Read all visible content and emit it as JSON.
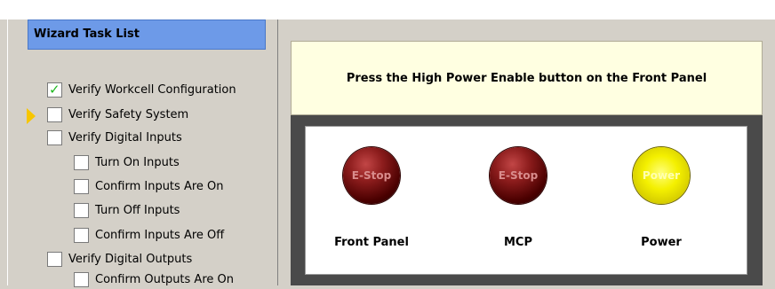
{
  "wizard": {
    "header": "Wizard Task List",
    "tasks": [
      {
        "label": "Verify Workcell Configuration",
        "checked": true
      },
      {
        "label": "Verify Safety System",
        "checked": false,
        "current": true
      },
      {
        "label": "Verify Digital Inputs",
        "checked": false
      },
      {
        "label": "Turn On Inputs",
        "checked": false
      },
      {
        "label": "Confirm Inputs Are On",
        "checked": false
      },
      {
        "label": "Turn Off Inputs",
        "checked": false
      },
      {
        "label": "Confirm Inputs Are Off",
        "checked": false
      },
      {
        "label": "Verify Digital Outputs",
        "checked": false
      },
      {
        "label": "Confirm Outputs Are On",
        "checked": false
      }
    ]
  },
  "instruction": "Press the High Power Enable button on the Front Panel",
  "indicators": [
    {
      "text": "E-Stop",
      "label": "Front Panel",
      "color": "#8d1d1d"
    },
    {
      "text": "E-Stop",
      "label": "MCP",
      "color": "#8d1d1d"
    },
    {
      "text": "Power",
      "label": "Power",
      "color": "#f4f000"
    }
  ],
  "colors": {
    "header_bg": "#6d9ae8",
    "instruction_bg": "#ffffe1",
    "checkmark": "#1fb81f",
    "current_arrow": "#f7c600"
  }
}
